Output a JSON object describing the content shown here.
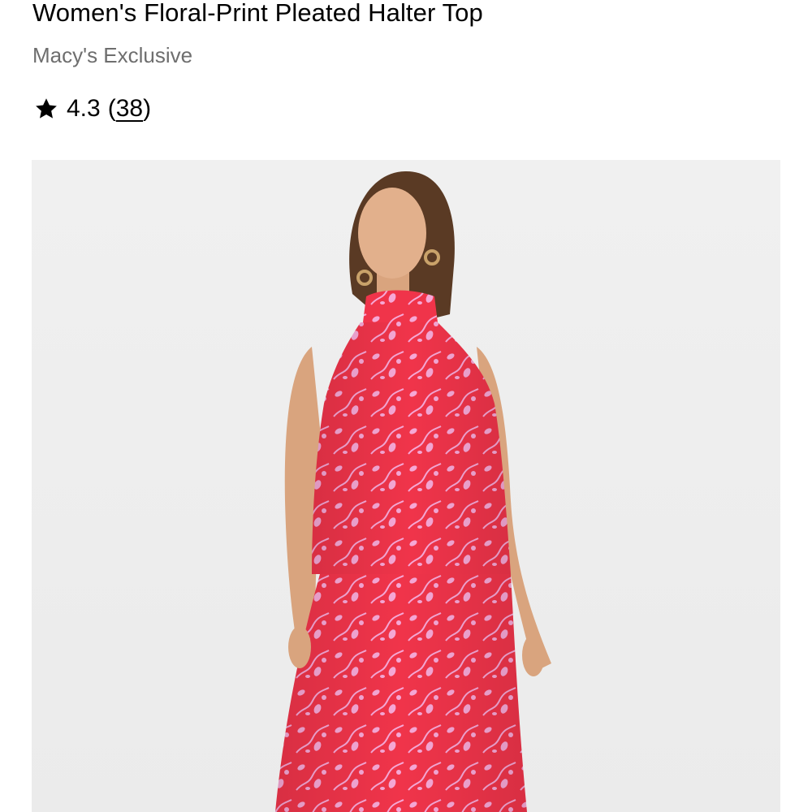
{
  "product": {
    "title": "Women's Floral-Print Pleated Halter Top",
    "brand": "Macy's Exclusive",
    "rating": {
      "icon": "star-icon",
      "value": "4.3",
      "open_paren": "(",
      "count": "38",
      "close_paren": ")"
    },
    "image": {
      "description_icon": "product-photo",
      "background_color": "#efefef",
      "garment_color": "#f0344a",
      "print_color": "#f6a8d6"
    }
  }
}
